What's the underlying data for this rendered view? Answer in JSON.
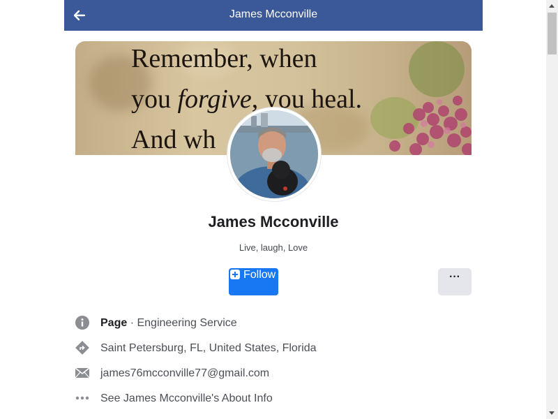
{
  "header": {
    "title": "James Mcconville",
    "back_icon": "arrow-left-icon"
  },
  "cover": {
    "quote_line1": "Remember, when",
    "quote_line2_a": "you ",
    "quote_line2_b": "forgive",
    "quote_line2_c": ", you heal.",
    "quote_line3": "And wh"
  },
  "profile": {
    "name": "James Mcconville",
    "tagline": "Live, laugh, Love"
  },
  "actions": {
    "follow_label": "Follow",
    "more_label": "···"
  },
  "info": {
    "page_label": "Page",
    "separator": " · ",
    "category": "Engineering Service",
    "location": "Saint Petersburg, FL, United States, Florida",
    "email": "james76mcconville77@gmail.com",
    "about": "See James Mcconville's About Info"
  },
  "colors": {
    "header_bg": "#3b5998",
    "accent": "#1877f2",
    "secondary_button": "#e4e6eb"
  }
}
